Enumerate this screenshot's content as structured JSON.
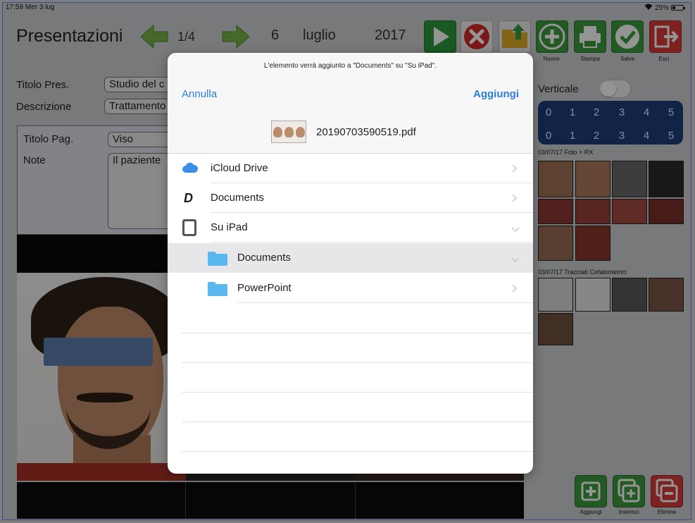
{
  "status_bar": {
    "time": "17:59",
    "date": "Mer 3 lug",
    "battery": "25%"
  },
  "app": {
    "title": "Presentazioni",
    "page_indicator": "1/4",
    "date_day": "6",
    "date_month": "luglio",
    "date_year": "2017",
    "toolbar": {
      "nuovo": "Nuovo",
      "stampa": "Stampa",
      "salva": "Salva",
      "esci": "Esci"
    },
    "form": {
      "titolo_pres_label": "Titolo Pres.",
      "titolo_pres_value": "Studio del c",
      "descrizione_label": "Descrizione",
      "descrizione_value": "Trattamento",
      "titolo_pag_label": "Titolo Pag.",
      "titolo_pag_value": "Viso",
      "note_label": "Note",
      "note_value": "Il paziente"
    },
    "right_panel": {
      "orientation_label": "Verticale",
      "grid_numbers": [
        "0",
        "1",
        "2",
        "3",
        "4",
        "5"
      ],
      "section1": "03/07/17 Foto + RX",
      "section2": "03/07/17 Tracciati Cefalometrici"
    },
    "actions": {
      "aggiungi": "Aggiungi",
      "inserisci": "Inserisci",
      "elimina": "Elimina"
    },
    "colors": {
      "nav_green": "#78b64a",
      "play_green": "#2e9a3c",
      "cancel_red": "#d42a2a",
      "toolbar_green": "#3d9c3e",
      "exit_red": "#d93a3a",
      "grid_blue": "#1e3e7c",
      "link_blue": "#2f7dd6",
      "folder_blue": "#5ab8f0"
    }
  },
  "modal": {
    "message": "L'elemento verrà aggiunto a \"Documents\" su \"Su iPad\".",
    "cancel": "Annulla",
    "add": "Aggiungi",
    "file_name": "20190703590519.pdf",
    "locations": [
      {
        "label": "iCloud Drive",
        "icon": "icloud-icon",
        "chevron": "right"
      },
      {
        "label": "Documents",
        "icon": "documents-app-icon",
        "chevron": "right"
      },
      {
        "label": "Su iPad",
        "icon": "ipad-icon",
        "chevron": "down"
      },
      {
        "label": "Documents",
        "icon": "folder-icon",
        "chevron": "down",
        "selected": true
      },
      {
        "label": "PowerPoint",
        "icon": "folder-icon",
        "chevron": "right"
      }
    ]
  }
}
